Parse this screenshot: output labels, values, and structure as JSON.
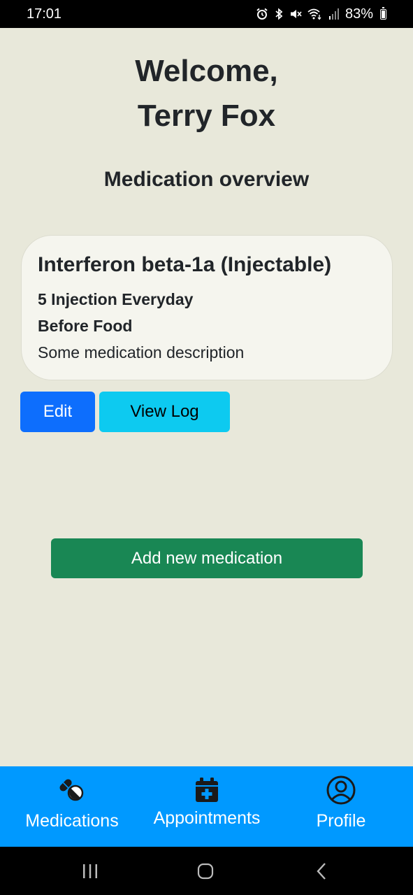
{
  "status_bar": {
    "time": "17:01",
    "battery": "83%",
    "battery_level": 0.83
  },
  "header": {
    "welcome_line1": "Welcome,",
    "welcome_line2": "Terry Fox",
    "section_title": "Medication overview"
  },
  "medication": {
    "name": "Interferon beta-1a (Injectable)",
    "frequency": "5 Injection Everyday",
    "timing": "Before Food",
    "description": "Some medication description"
  },
  "actions": {
    "edit_label": "Edit",
    "view_log_label": "View Log",
    "add_label": "Add new medication"
  },
  "bottom_nav": {
    "items": [
      {
        "label": "Medications",
        "icon": "pills-icon"
      },
      {
        "label": "Appointments",
        "icon": "calendar-plus-icon"
      },
      {
        "label": "Profile",
        "icon": "user-circle-icon"
      }
    ]
  },
  "colors": {
    "background": "#e8e8da",
    "card": "#f5f5ee",
    "edit_button": "#0d6efd",
    "view_log_button": "#0dcaf0",
    "add_button": "#198754",
    "bottom_nav": "#0099ff"
  }
}
